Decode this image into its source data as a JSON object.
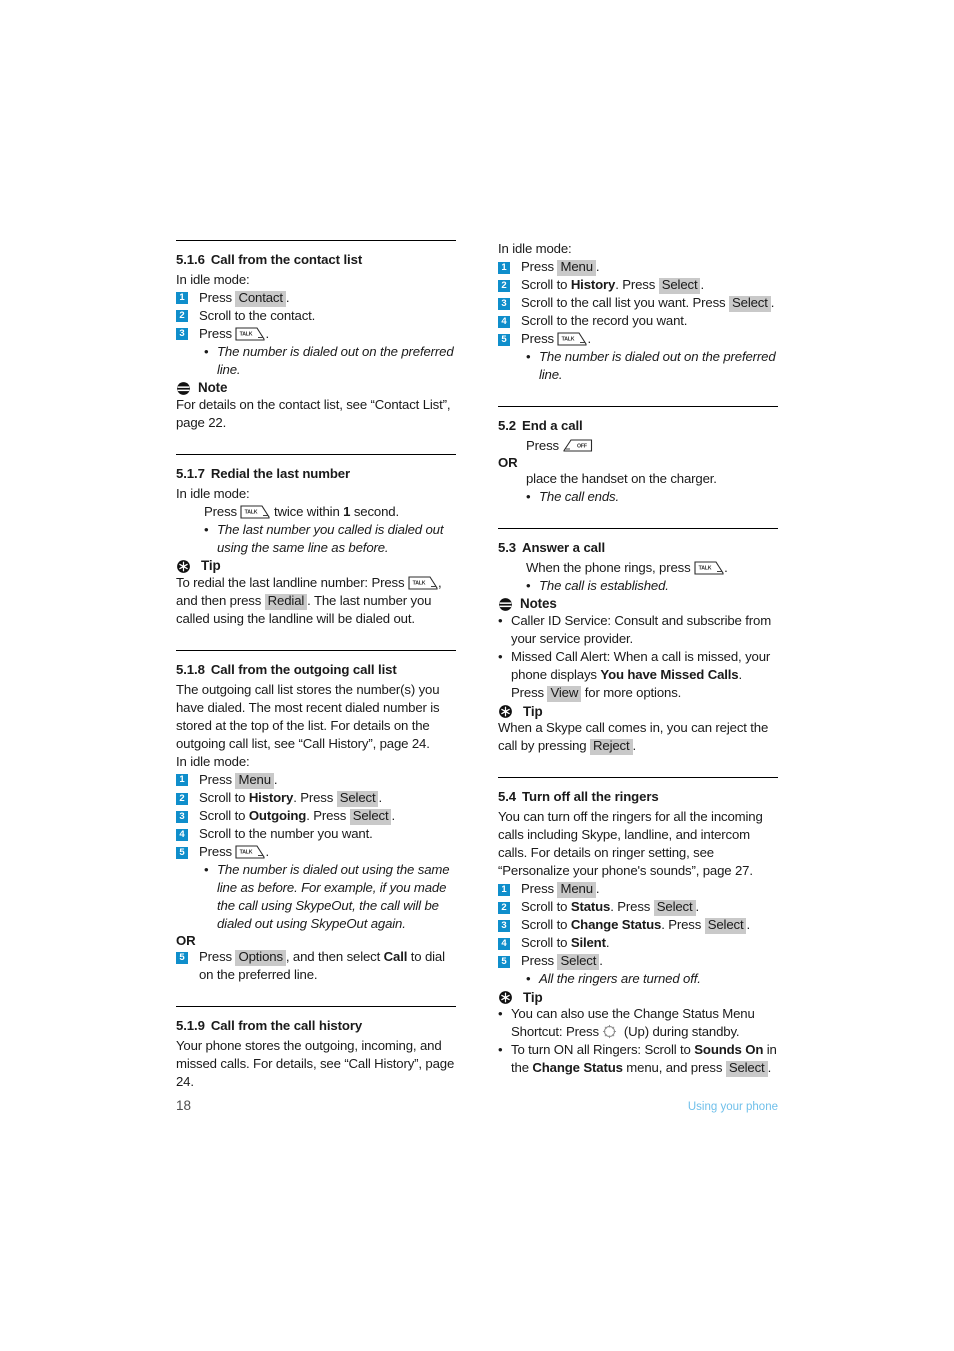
{
  "page": {
    "number": "18",
    "running_title": "Using your phone"
  },
  "icons": {
    "talk_key": "talk-key-icon",
    "off_key": "off-key-icon",
    "note": "note-icon",
    "tip": "tip-icon",
    "nav_up": "navigation-up-icon"
  },
  "keys": {
    "talk_label": "TALK",
    "off_label": "OFF"
  },
  "left_column": {
    "sections": [
      {
        "id": "5.1.6",
        "number": "5.1.6",
        "title": "Call from the contact list",
        "intro": "In idle mode:",
        "steps": [
          {
            "n": "1",
            "pre": "Press ",
            "softkey": "Contact",
            "post": "."
          },
          {
            "n": "2",
            "pre": "Scroll to the contact.",
            "softkey": "",
            "post": ""
          },
          {
            "n": "3",
            "pre": "Press ",
            "key": "talk",
            "post": "."
          }
        ],
        "bullet": "The number is dialed out on the preferred line.",
        "callout": {
          "type": "Note",
          "label": "Note"
        },
        "callout_body": "For details on the contact list, see “Contact List”, page 22."
      },
      {
        "id": "5.1.7",
        "number": "5.1.7",
        "title": "Redial the last number",
        "intro": "In idle mode:",
        "press_line_pre": "Press ",
        "press_line_post_a": " twice within ",
        "press_line_bold": "1",
        "press_line_post_b": " second.",
        "bullet": "The last number you called is dialed out using the same line as before.",
        "callout": {
          "type": "Tip",
          "label": "Tip"
        },
        "tip_a": "To redial the last landline number: Press ",
        "tip_b": ", and then press ",
        "tip_softkey": "Redial",
        "tip_c": ". The last number you called using the landline will be dialed out."
      },
      {
        "id": "5.1.8",
        "number": "5.1.8",
        "title": "Call from the outgoing call list",
        "body": "The outgoing call list stores the number(s) you have dialed. The most recent dialed number is stored at the top of the list. For details on the outgoing call list, see “Call History”, page 24.",
        "intro": "In idle mode:",
        "steps": [
          {
            "n": "1",
            "pre": "Press ",
            "softkey": "Menu",
            "post": "."
          },
          {
            "n": "2",
            "pre": "Scroll to ",
            "bold": "History",
            "mid": ". Press ",
            "softkey": "Select",
            "post": "."
          },
          {
            "n": "3",
            "pre": "Scroll to ",
            "bold": "Outgoing",
            "mid": ". Press ",
            "softkey": "Select",
            "post": "."
          },
          {
            "n": "4",
            "pre": "Scroll to the number you want.",
            "softkey": "",
            "post": ""
          },
          {
            "n": "5",
            "pre": "Press ",
            "key": "talk",
            "post": "."
          }
        ],
        "bullet": "The number is dialed out using the same line as before. For example, if you made the call using SkypeOut, the call will be dialed out using SkypeOut again.",
        "or": "OR",
        "or_step": {
          "n": "5",
          "pre": "Press ",
          "softkey": "Options",
          "mid": ", and then select ",
          "bold": "Call",
          "post": " to dial on the preferred line."
        }
      },
      {
        "id": "5.1.9",
        "number": "5.1.9",
        "title": "Call from the call history",
        "body": "Your phone stores the outgoing, incoming, and missed calls. For details, see “Call History”, page 24."
      }
    ]
  },
  "right_column": {
    "top_block": {
      "intro": "In idle mode:",
      "steps": [
        {
          "n": "1",
          "pre": "Press ",
          "softkey": "Menu",
          "post": "."
        },
        {
          "n": "2",
          "pre": "Scroll to ",
          "bold": "History",
          "mid": ". Press ",
          "softkey": "Select",
          "post": "."
        },
        {
          "n": "3",
          "pre": "Scroll to the call list you want. Press ",
          "softkey": "Select",
          "post": "."
        },
        {
          "n": "4",
          "pre": "Scroll to the record you want.",
          "softkey": "",
          "post": ""
        },
        {
          "n": "5",
          "pre": "Press ",
          "key": "talk",
          "post": "."
        }
      ],
      "bullet": "The number is dialed out on the preferred line."
    },
    "sections": [
      {
        "id": "5.2",
        "number": "5.2",
        "title": "End a call",
        "press_pre": "Press ",
        "or": "OR",
        "or_body": "place the handset on the charger.",
        "bullet": "The call ends."
      },
      {
        "id": "5.3",
        "number": "5.3",
        "title": "Answer a call",
        "press_pre": "When the phone rings, press ",
        "press_post": ".",
        "bullet": "The call is established.",
        "callout": {
          "type": "Note",
          "label": "Notes"
        },
        "notes": [
          {
            "text": "Caller ID Service: Consult and subscribe from your service provider."
          },
          {
            "pre": "Missed Call Alert: When a call is missed, your phone displays ",
            "bold": "You have Missed Calls",
            "mid": ". Press ",
            "softkey": "View",
            "post": " for more options."
          }
        ],
        "tip_callout": {
          "type": "Tip",
          "label": "Tip"
        },
        "tip_pre": "When a Skype call comes in, you can reject the call by pressing ",
        "tip_softkey": "Reject",
        "tip_post": "."
      },
      {
        "id": "5.4",
        "number": "5.4",
        "title": "Turn off all the ringers",
        "body": "You can turn off the ringers for all the incoming calls including Skype, landline, and intercom calls. For details on ringer setting, see “Personalize your phone's sounds”, page 27.",
        "steps": [
          {
            "n": "1",
            "pre": "Press ",
            "softkey": "Menu",
            "post": "."
          },
          {
            "n": "2",
            "pre": "Scroll to ",
            "bold": "Status",
            "mid": ". Press ",
            "softkey": "Select",
            "post": "."
          },
          {
            "n": "3",
            "pre": "Scroll to ",
            "bold": "Change Status",
            "mid": ". Press ",
            "softkey": "Select",
            "post": "."
          },
          {
            "n": "4",
            "pre": "Scroll to ",
            "bold": "Silent",
            "mid": ".",
            "softkey": "",
            "post": ""
          },
          {
            "n": "5",
            "pre": "Press ",
            "softkey": "Select",
            "post": "."
          }
        ],
        "bullet": "All the ringers are turned off.",
        "tip_callout": {
          "type": "Tip",
          "label": "Tip"
        },
        "tips": [
          {
            "pre": "You can also use the Change Status Menu Shortcut: Press ",
            "post": " (Up) during standby."
          },
          {
            "pre": "To turn ON all Ringers: Scroll to ",
            "bold": "Sounds On",
            "mid": " in the ",
            "bold2": "Change Status",
            "mid2": " menu, and press ",
            "softkey": "Select",
            "post": "."
          }
        ]
      }
    ]
  },
  "colors": {
    "step_marker": "#0f8ecb",
    "softkey_bg": "#c9c9c9",
    "footer_title": "#6fbfea",
    "text": "#1a1a1a"
  }
}
